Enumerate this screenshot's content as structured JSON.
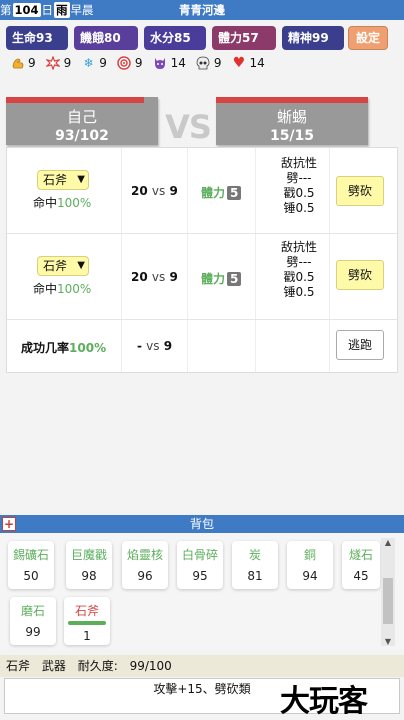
{
  "topbar": {
    "prefix": "第",
    "day": "104",
    "day_suffix": "日",
    "weather": "雨",
    "time": "早晨",
    "location": "青青河邊"
  },
  "stats": [
    {
      "label": "生命93",
      "color": "#3a3e8c"
    },
    {
      "label": "饑餓80",
      "color": "#5a3e9c"
    },
    {
      "label": "水分85",
      "color": "#4a3c9a"
    },
    {
      "label": "體力57",
      "color": "#8b3a6a"
    },
    {
      "label": "精神99",
      "color": "#3a3e8c"
    }
  ],
  "settings_label": "設定",
  "attributes": [
    {
      "icon": "muscle-icon",
      "value": "9"
    },
    {
      "icon": "burst-icon",
      "value": "9"
    },
    {
      "icon": "snowflake-icon",
      "value": "9"
    },
    {
      "icon": "target-icon",
      "value": "9"
    },
    {
      "icon": "demon-icon",
      "value": "14"
    },
    {
      "icon": "skull-icon",
      "value": "9"
    },
    {
      "icon": "heart-icon",
      "value": "14"
    }
  ],
  "player": {
    "name": "自己",
    "hp": "93/102",
    "hp_fraction": 0.91
  },
  "vs_text": "VS",
  "enemy": {
    "name": "蜥蜴",
    "hp": "15/15",
    "hp_fraction": 1.0
  },
  "attack_rows": [
    {
      "weapon": "石斧",
      "hit_label": "命中",
      "hit_value": "100%",
      "vs_left": "20",
      "vs_mid": "vs",
      "vs_right": "9",
      "power_label": "體力",
      "power_value": "5",
      "resist": [
        "敌抗性",
        "劈---",
        "戳0.5",
        "锤0.5"
      ],
      "action": "劈砍"
    },
    {
      "weapon": "石斧",
      "hit_label": "命中",
      "hit_value": "100%",
      "vs_left": "20",
      "vs_mid": "vs",
      "vs_right": "9",
      "power_label": "體力",
      "power_value": "5",
      "resist": [
        "敌抗性",
        "劈---",
        "戳0.5",
        "锤0.5"
      ],
      "action": "劈砍"
    }
  ],
  "flee_row": {
    "label": "成功几率",
    "value": "100%",
    "vs_left": "-",
    "vs_mid": "vs",
    "vs_right": "9",
    "action": "逃跑"
  },
  "bag": {
    "title": "背包",
    "plus": "+",
    "items": [
      {
        "name": "錫礦石",
        "count": "50"
      },
      {
        "name": "巨魔戳",
        "count": "98"
      },
      {
        "name": "焰靈核",
        "count": "96"
      },
      {
        "name": "白骨碎",
        "count": "95"
      },
      {
        "name": "炭",
        "count": "81"
      },
      {
        "name": "銅",
        "count": "94"
      },
      {
        "name": "燧石",
        "count": "45"
      },
      {
        "name": "磨石",
        "count": "99"
      },
      {
        "name": "石斧",
        "count": "1"
      }
    ]
  },
  "selected_info": {
    "name": "石斧",
    "type": "武器",
    "durability_label": "耐久度:",
    "durability": "99/100",
    "description": "攻擊+15、劈砍類"
  },
  "watermark": "大玩客"
}
